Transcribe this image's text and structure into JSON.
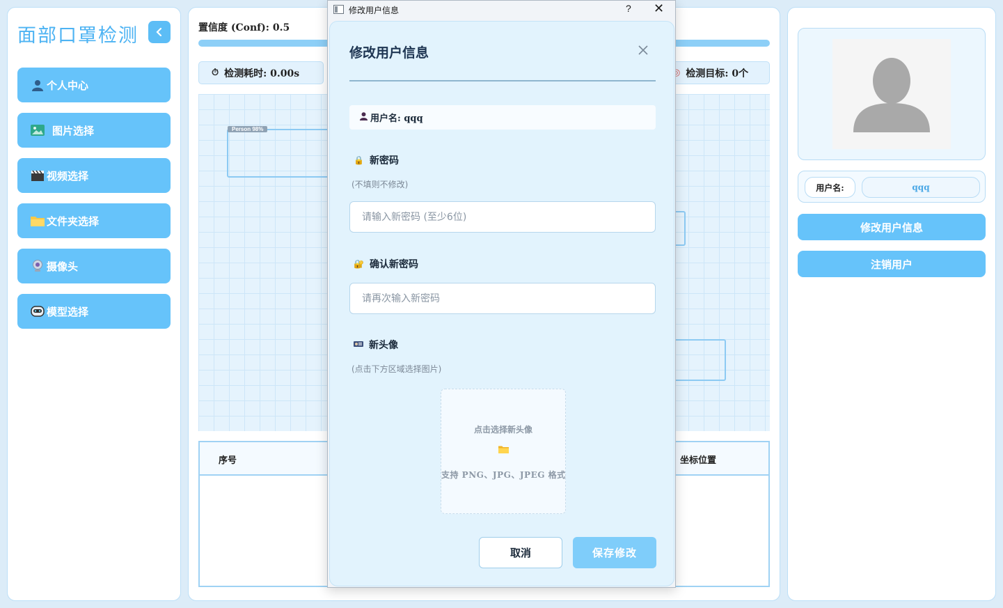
{
  "app": {
    "title": "面部口罩检测"
  },
  "sidebar": {
    "items": [
      {
        "label": "个人中心",
        "icon": "person-icon"
      },
      {
        "label": "图片选择",
        "icon": "image-icon"
      },
      {
        "label": "视频选择",
        "icon": "clapper-icon"
      },
      {
        "label": "文件夹选择",
        "icon": "folder-icon"
      },
      {
        "label": "摄像头",
        "icon": "webcam-icon"
      },
      {
        "label": "模型选择",
        "icon": "robot-icon"
      }
    ]
  },
  "controls": {
    "confidence_label": "置信度 (Conf): 0.5",
    "confidence_value": 0.5
  },
  "stats": {
    "time_label": "检测耗时: 0.00s",
    "targets_label": "检测目标: 0个"
  },
  "preview": {
    "detection_label": "Person 98%"
  },
  "table": {
    "headers": [
      "序号",
      "坐标位置"
    ]
  },
  "profile": {
    "username_label": "用户名:",
    "username_value": "qqq",
    "edit_button": "修改用户信息",
    "logout_button": "注销用户"
  },
  "dialog": {
    "window_title": "修改用户信息",
    "help_glyph": "?",
    "close_glyph": "✕",
    "heading": "修改用户信息",
    "username_text": "用户名: qqq",
    "new_password_label": "新密码",
    "new_password_hint": "(不填则不修改)",
    "new_password_placeholder": "请输入新密码 (至少6位)",
    "confirm_password_label": "确认新密码",
    "confirm_password_placeholder": "请再次输入新密码",
    "new_avatar_label": "新头像",
    "new_avatar_hint": "(点击下方区域选择图片)",
    "upload_title": "点击选择新头像",
    "upload_formats": "支持 PNG、JPG、JPEG 格式",
    "cancel_button": "取消",
    "save_button": "保存修改"
  },
  "colors": {
    "accent": "#66c3fa",
    "title": "#4db3f3",
    "dialog_bg": "#e2f3fd"
  }
}
